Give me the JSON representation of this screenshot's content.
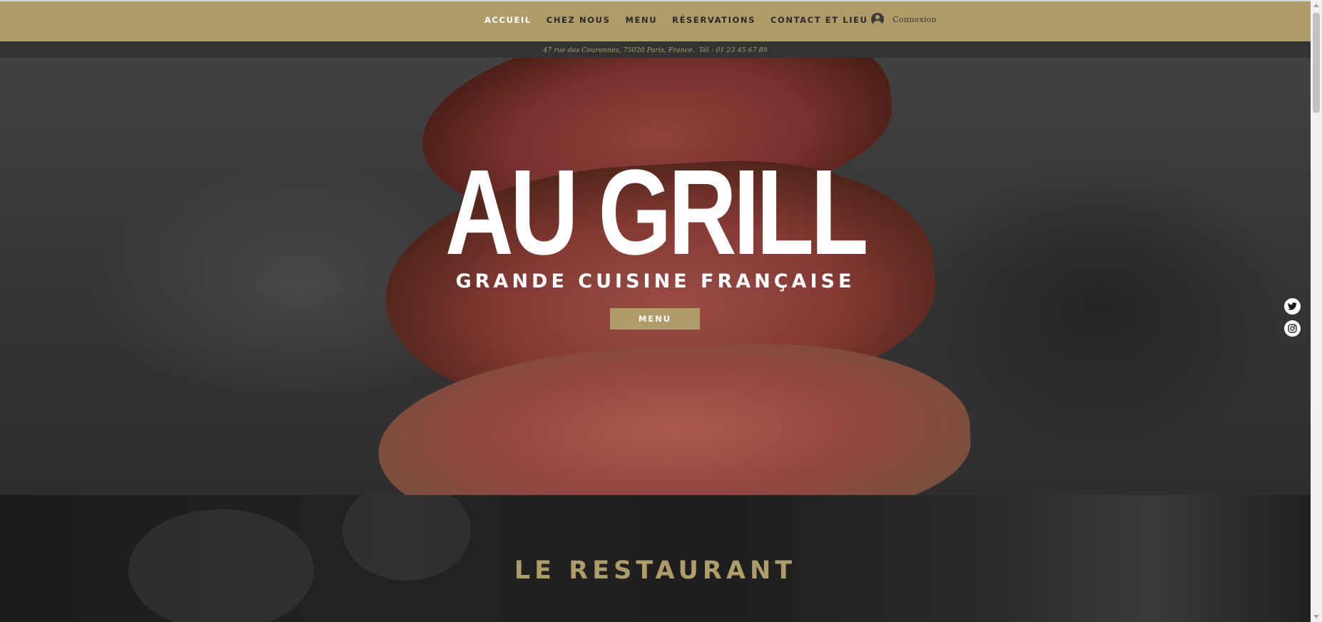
{
  "colors": {
    "gold": "#ae9c69",
    "dark": "#333333",
    "white": "#ffffff"
  },
  "nav": {
    "items": [
      {
        "label": "ACCUEIL",
        "active": true
      },
      {
        "label": "CHEZ NOUS"
      },
      {
        "label": "MENU"
      },
      {
        "label": "RÉSERVATIONS"
      },
      {
        "label": "CONTACT ET LIEU"
      }
    ],
    "login_label": "Connexion",
    "login_icon": "user-avatar-icon"
  },
  "infobar": {
    "text": "47 rue des Couronnes, 75020 Paris, France.  Tél : 01 23 45 67 89"
  },
  "hero": {
    "title": "AU GRILL",
    "subtitle": "GRANDE CUISINE FRANÇAISE",
    "button_label": "MENU"
  },
  "social": {
    "icons": [
      "twitter-icon",
      "instagram-icon"
    ]
  },
  "restaurant": {
    "title": "LE RESTAURANT"
  }
}
